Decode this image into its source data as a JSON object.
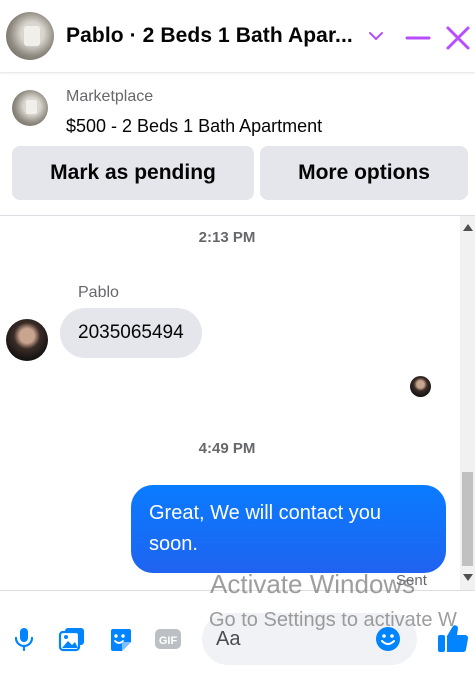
{
  "header": {
    "title": "Pablo · 2 Beds 1 Bath Apar...",
    "accent_color": "#b84dff",
    "icons": [
      "chevron-down-icon",
      "minimize-icon",
      "close-icon"
    ]
  },
  "listing": {
    "source": "Marketplace",
    "price_title": "$500 - 2 Beds 1 Bath Apartment",
    "buttons": {
      "mark_pending": "Mark as pending",
      "more_options": "More options"
    }
  },
  "thread": {
    "timestamp_1": "2:13 PM",
    "incoming": {
      "sender": "Pablo",
      "text": "2035065494"
    },
    "timestamp_2": "4:49 PM",
    "outgoing": {
      "text": "Great, We will contact you soon.",
      "status": "Sent",
      "bubble_color": "#0a7cff"
    }
  },
  "composer": {
    "placeholder": "Aa",
    "icons": [
      "microphone-icon",
      "photo-icon",
      "sticker-icon",
      "gif-icon",
      "emoji-icon",
      "like-icon"
    ],
    "gif_label": "GIF",
    "accent_color": "#0084ff"
  },
  "watermark": {
    "line1": "Activate Windows",
    "line2": "Go to Settings to activate W"
  }
}
